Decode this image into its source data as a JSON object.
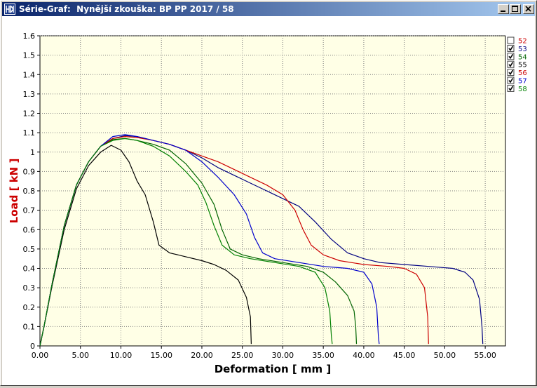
{
  "window": {
    "title": "Série-Graf:  Nynější zkouška: BP PP 2017 / 58",
    "icons": {
      "app": "app-logo-icon",
      "minimize": "minimize-icon",
      "maximize": "maximize-icon",
      "close": "close-icon"
    }
  },
  "chart_data": {
    "type": "line",
    "xlabel": "Deformation [ mm ]",
    "ylabel": "Load [ kN ]",
    "xlim": [
      0,
      57.5
    ],
    "ylim": [
      0,
      1.6
    ],
    "x_ticks": [
      "0.00",
      "5.00",
      "10.00",
      "15.00",
      "20.00",
      "25.00",
      "30.00",
      "35.00",
      "40.00",
      "45.00",
      "50.00",
      "55.00"
    ],
    "y_ticks": [
      "0",
      "0.1",
      "0.2",
      "0.3",
      "0.4",
      "0.5",
      "0.6",
      "0.7",
      "0.8",
      "0.9",
      "1",
      "1.1",
      "1.2",
      "1.3",
      "1.4",
      "1.5",
      "1.6"
    ],
    "grid": true,
    "legend_position": "top-right",
    "background": "#ffffe6",
    "series": [
      {
        "name": "52",
        "checked": false,
        "color": "#cc0000",
        "points": []
      },
      {
        "name": "53",
        "checked": true,
        "color": "#000080",
        "points": [
          [
            0,
            0
          ],
          [
            0.5,
            0.1
          ],
          [
            1.5,
            0.32
          ],
          [
            3,
            0.62
          ],
          [
            4.5,
            0.83
          ],
          [
            6,
            0.95
          ],
          [
            7.5,
            1.03
          ],
          [
            9,
            1.07
          ],
          [
            10.5,
            1.085
          ],
          [
            12,
            1.08
          ],
          [
            14,
            1.06
          ],
          [
            16,
            1.04
          ],
          [
            18,
            1.01
          ],
          [
            20,
            0.97
          ],
          [
            22,
            0.92
          ],
          [
            24,
            0.88
          ],
          [
            26,
            0.84
          ],
          [
            28,
            0.8
          ],
          [
            30,
            0.76
          ],
          [
            32,
            0.72
          ],
          [
            34,
            0.64
          ],
          [
            36,
            0.55
          ],
          [
            38,
            0.48
          ],
          [
            40,
            0.45
          ],
          [
            42,
            0.43
          ],
          [
            45,
            0.42
          ],
          [
            48,
            0.41
          ],
          [
            51,
            0.4
          ],
          [
            52.5,
            0.38
          ],
          [
            53.5,
            0.34
          ],
          [
            54.3,
            0.24
          ],
          [
            54.6,
            0.1
          ],
          [
            54.7,
            0.01
          ]
        ]
      },
      {
        "name": "54",
        "checked": true,
        "color": "#006400",
        "points": [
          [
            0,
            0
          ],
          [
            0.5,
            0.1
          ],
          [
            1.5,
            0.32
          ],
          [
            3,
            0.62
          ],
          [
            4.5,
            0.83
          ],
          [
            6,
            0.95
          ],
          [
            7.5,
            1.03
          ],
          [
            9,
            1.065
          ],
          [
            10.5,
            1.07
          ],
          [
            12,
            1.06
          ],
          [
            14,
            1.04
          ],
          [
            16,
            1.01
          ],
          [
            18,
            0.94
          ],
          [
            20,
            0.84
          ],
          [
            21.5,
            0.73
          ],
          [
            22.5,
            0.6
          ],
          [
            23.5,
            0.5
          ],
          [
            25,
            0.47
          ],
          [
            27,
            0.45
          ],
          [
            30,
            0.43
          ],
          [
            33,
            0.41
          ],
          [
            35,
            0.38
          ],
          [
            36.5,
            0.33
          ],
          [
            38,
            0.26
          ],
          [
            38.8,
            0.18
          ],
          [
            39,
            0.1
          ],
          [
            39.1,
            0.01
          ]
        ]
      },
      {
        "name": "55",
        "checked": true,
        "color": "#000000",
        "points": [
          [
            0,
            0
          ],
          [
            0.5,
            0.1
          ],
          [
            1.5,
            0.31
          ],
          [
            3,
            0.6
          ],
          [
            4.5,
            0.81
          ],
          [
            6,
            0.93
          ],
          [
            7.5,
            1.0
          ],
          [
            8.8,
            1.035
          ],
          [
            10,
            1.01
          ],
          [
            11,
            0.95
          ],
          [
            12,
            0.85
          ],
          [
            13,
            0.78
          ],
          [
            14,
            0.64
          ],
          [
            14.7,
            0.52
          ],
          [
            16,
            0.48
          ],
          [
            18,
            0.46
          ],
          [
            20,
            0.44
          ],
          [
            21.5,
            0.42
          ],
          [
            23,
            0.39
          ],
          [
            24.5,
            0.34
          ],
          [
            25.5,
            0.25
          ],
          [
            26,
            0.15
          ],
          [
            26.1,
            0.01
          ]
        ]
      },
      {
        "name": "56",
        "checked": true,
        "color": "#cc0000",
        "points": [
          [
            0,
            0
          ],
          [
            0.5,
            0.1
          ],
          [
            1.5,
            0.32
          ],
          [
            3,
            0.62
          ],
          [
            4.5,
            0.83
          ],
          [
            6,
            0.95
          ],
          [
            7.5,
            1.03
          ],
          [
            9,
            1.07
          ],
          [
            10.5,
            1.08
          ],
          [
            12,
            1.075
          ],
          [
            14,
            1.06
          ],
          [
            16,
            1.04
          ],
          [
            18,
            1.01
          ],
          [
            20,
            0.98
          ],
          [
            22,
            0.95
          ],
          [
            24,
            0.91
          ],
          [
            26,
            0.87
          ],
          [
            28,
            0.83
          ],
          [
            30,
            0.78
          ],
          [
            31.5,
            0.7
          ],
          [
            32.5,
            0.6
          ],
          [
            33.5,
            0.52
          ],
          [
            35,
            0.47
          ],
          [
            37,
            0.44
          ],
          [
            40,
            0.42
          ],
          [
            43,
            0.41
          ],
          [
            45,
            0.4
          ],
          [
            46.5,
            0.37
          ],
          [
            47.5,
            0.3
          ],
          [
            47.9,
            0.15
          ],
          [
            48,
            0.01
          ]
        ]
      },
      {
        "name": "57",
        "checked": true,
        "color": "#0000cc",
        "points": [
          [
            0,
            0
          ],
          [
            0.5,
            0.1
          ],
          [
            1.5,
            0.32
          ],
          [
            3,
            0.62
          ],
          [
            4.5,
            0.83
          ],
          [
            6,
            0.95
          ],
          [
            7.5,
            1.03
          ],
          [
            9,
            1.08
          ],
          [
            10.5,
            1.09
          ],
          [
            12,
            1.08
          ],
          [
            14,
            1.06
          ],
          [
            16,
            1.04
          ],
          [
            18,
            1.01
          ],
          [
            20,
            0.95
          ],
          [
            22,
            0.87
          ],
          [
            24,
            0.78
          ],
          [
            25.5,
            0.68
          ],
          [
            26.5,
            0.56
          ],
          [
            27.5,
            0.48
          ],
          [
            29,
            0.45
          ],
          [
            32,
            0.43
          ],
          [
            35,
            0.41
          ],
          [
            38,
            0.4
          ],
          [
            40,
            0.38
          ],
          [
            41,
            0.32
          ],
          [
            41.6,
            0.2
          ],
          [
            41.8,
            0.05
          ],
          [
            41.9,
            0.01
          ]
        ]
      },
      {
        "name": "58",
        "checked": true,
        "color": "#008000",
        "points": [
          [
            0,
            0
          ],
          [
            0.5,
            0.1
          ],
          [
            1.5,
            0.32
          ],
          [
            3,
            0.62
          ],
          [
            4.5,
            0.83
          ],
          [
            6,
            0.95
          ],
          [
            7.5,
            1.03
          ],
          [
            9,
            1.06
          ],
          [
            10.5,
            1.07
          ],
          [
            12,
            1.06
          ],
          [
            14,
            1.03
          ],
          [
            16,
            0.98
          ],
          [
            18,
            0.9
          ],
          [
            19.5,
            0.83
          ],
          [
            20.5,
            0.74
          ],
          [
            21.5,
            0.62
          ],
          [
            22.5,
            0.52
          ],
          [
            24,
            0.47
          ],
          [
            26,
            0.45
          ],
          [
            29,
            0.43
          ],
          [
            32,
            0.41
          ],
          [
            34,
            0.38
          ],
          [
            35.2,
            0.3
          ],
          [
            35.8,
            0.18
          ],
          [
            36,
            0.05
          ],
          [
            36.1,
            0.01
          ]
        ]
      }
    ]
  }
}
